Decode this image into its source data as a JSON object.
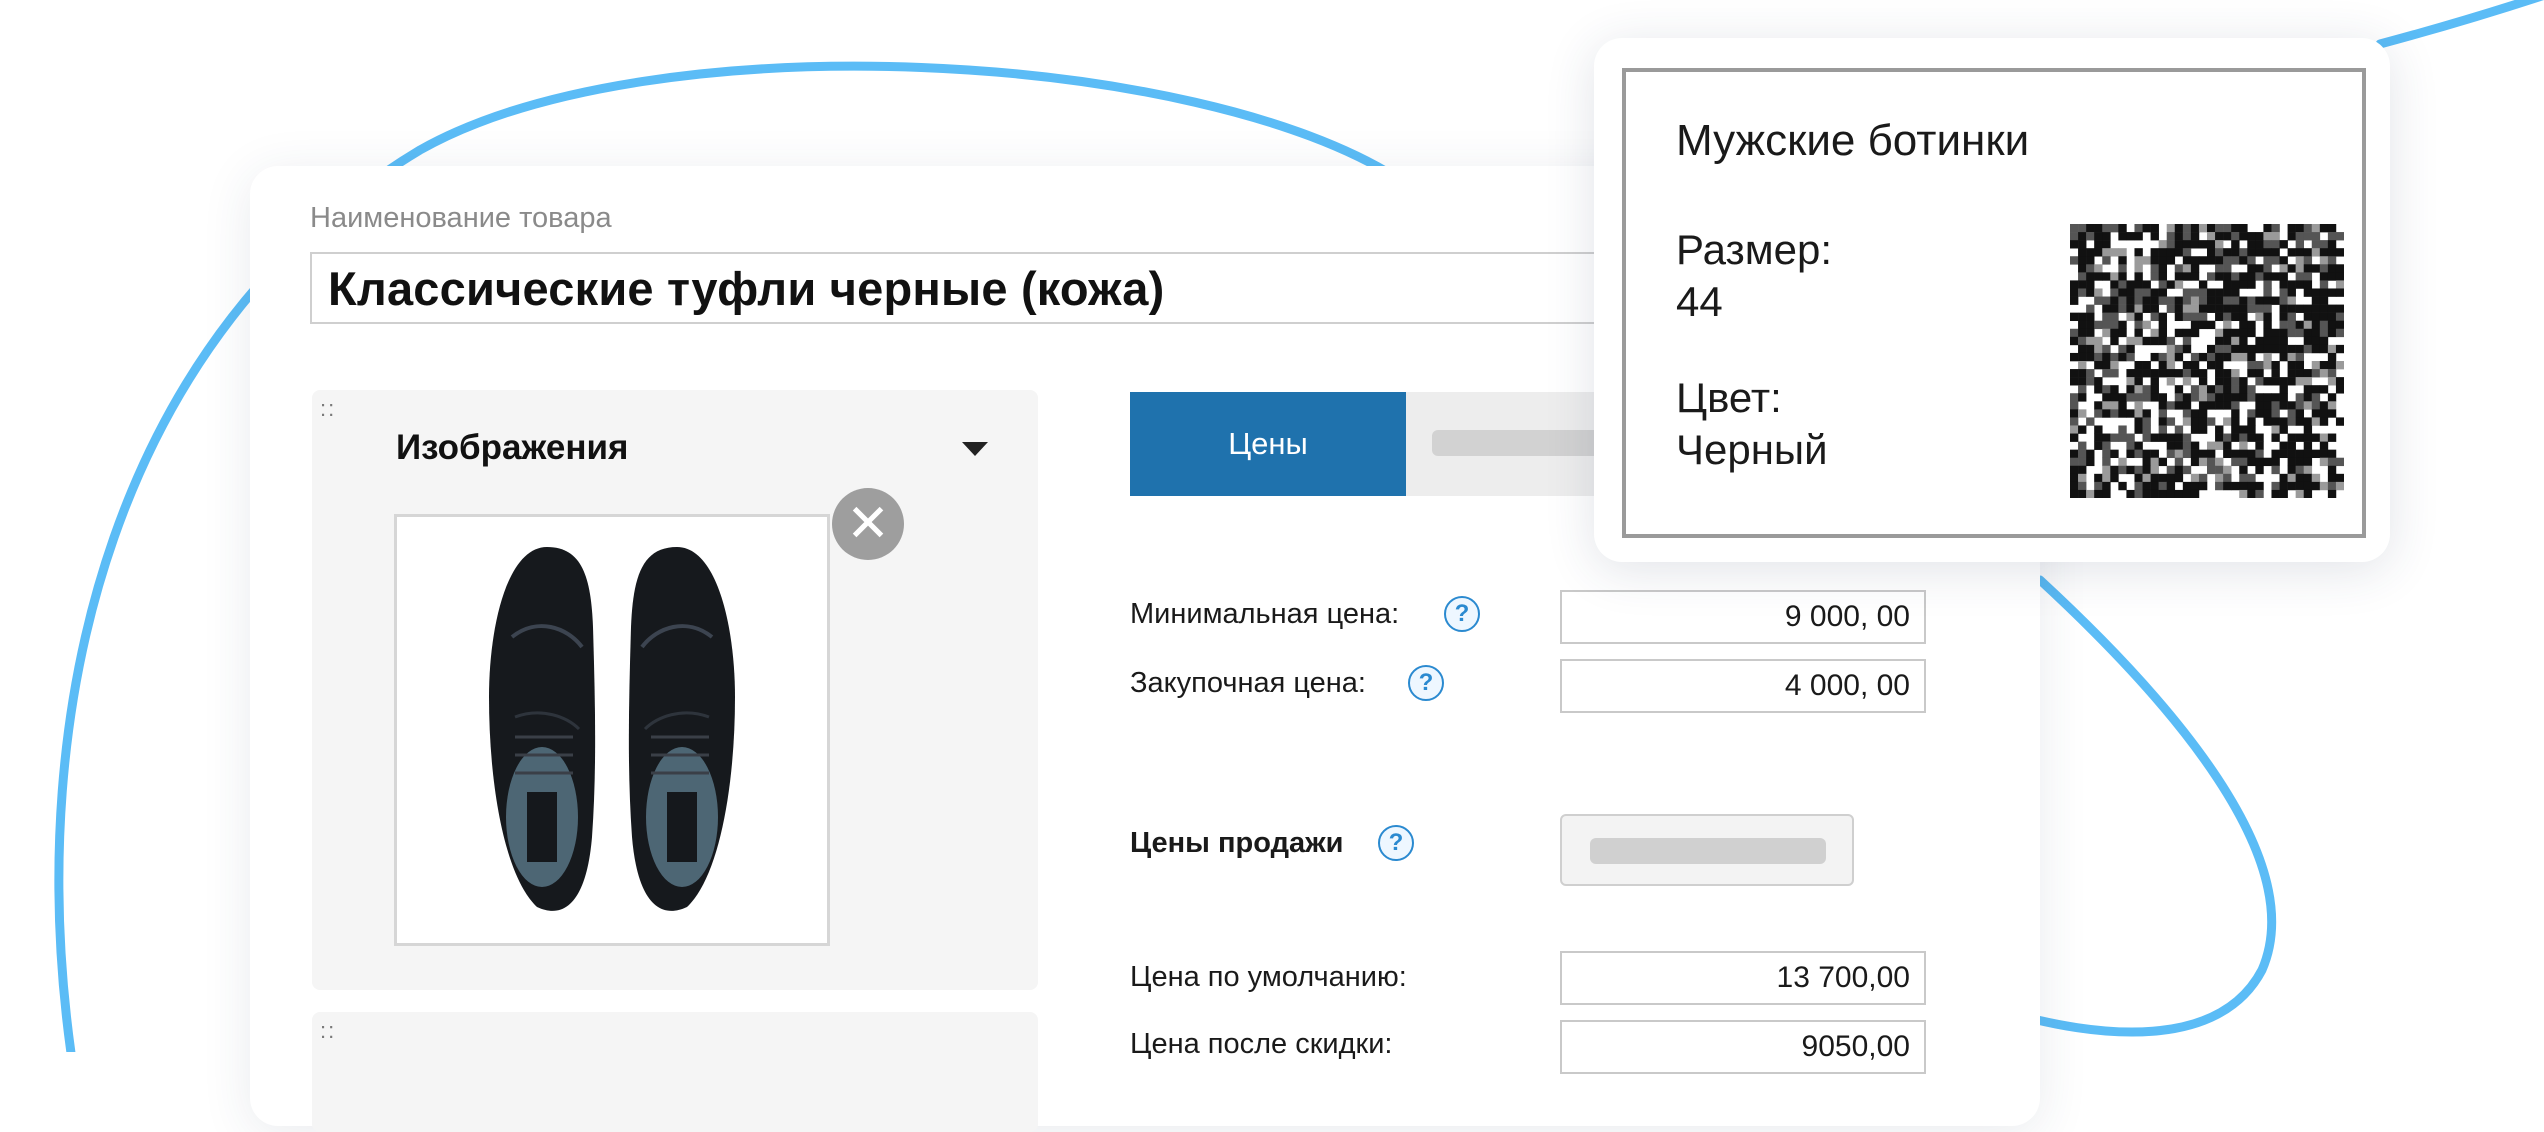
{
  "product": {
    "name_label": "Наименование товара",
    "name_value": "Классические туфли черные (кожа)"
  },
  "images_panel": {
    "title": "Изображения",
    "drag_handle": "::"
  },
  "tabs": [
    {
      "label": "Цены",
      "active": true
    }
  ],
  "prices": {
    "min_price_label": "Минимальная цена:",
    "min_price_value": "9 000, 00",
    "purchase_price_label": "Закупочная цена:",
    "purchase_price_value": "4 000, 00",
    "sale_prices_label": "Цены продажи",
    "default_price_label": "Цена по умолчанию:",
    "default_price_value": "13 700,00",
    "discount_price_label": "Цена после скидки:",
    "discount_price_value": "9050,00"
  },
  "help_icon_glyph": "?",
  "close_icon_glyph": "✕",
  "label_card": {
    "title": "Мужские ботинки",
    "size_label": "Размер:",
    "size_value": "44",
    "color_label": "Цвет:",
    "color_value": "Черный"
  },
  "colors": {
    "accent": "#1f72ad",
    "curve": "#5bbcf6",
    "help": "#2b8ad0"
  },
  "icons": [
    "close-icon",
    "help-icon",
    "chevron-down-icon",
    "drag-handle-icon",
    "qr-code-icon"
  ]
}
